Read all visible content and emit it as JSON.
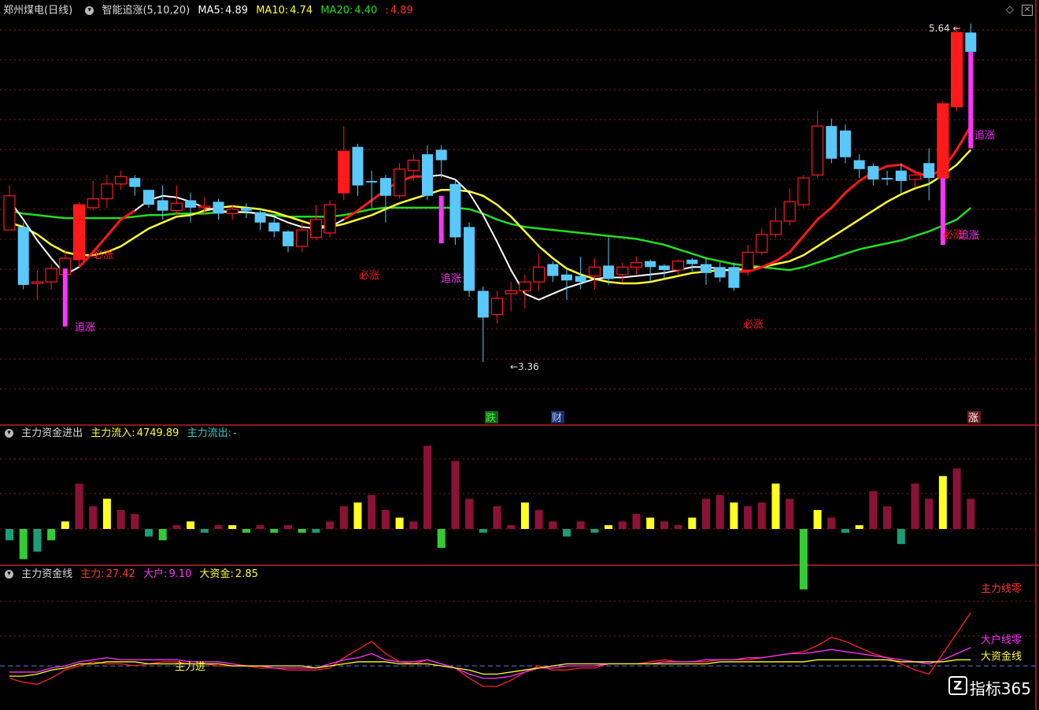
{
  "main_panel": {
    "symbol": "郑州煤电",
    "period": "(日线)",
    "indicator": "智能追涨(5,10,20)",
    "ma5_label": "MA5:",
    "ma5_value": "4.89",
    "ma10_label": "MA10:",
    "ma10_value": "4.74",
    "ma20_label": "MA20:",
    "ma20_value": "4.40",
    "extra_value": "4.89",
    "high_label": "5.64",
    "low_label": "3.36",
    "signal_labels": [
      "追涨",
      "必涨",
      "必涨",
      "追涨",
      "必涨",
      "追涨",
      "必涨",
      "追涨"
    ],
    "event_labels": [
      "跌",
      "财",
      "涨"
    ]
  },
  "flow_panel": {
    "title": "主力资金进出",
    "inflow_label": "主力流入:",
    "inflow_value": "4749.89",
    "outflow_label": "主力流出:",
    "outflow_value": "-"
  },
  "line_panel": {
    "title": "主力资金线",
    "zl_label": "主力:",
    "zl_value": "27.42",
    "dh_label": "大户:",
    "dh_value": "9.10",
    "dzj_label": "大资金:",
    "dzj_value": "2.85",
    "annot_main_in": "主力进",
    "annot_zl": "主力线零",
    "annot_dh": "大户线零",
    "annot_dzj": "大资金线"
  },
  "watermark": "指标365",
  "colors": {
    "up": "#ff1a1a",
    "down": "#5ac8fa",
    "ma5": "#ffffff",
    "ma10": "#ffff33",
    "ma20": "#22dd22",
    "magenta": "#ff33ff",
    "grid": "#8b1a1a"
  },
  "chart_data": [
    {
      "type": "candlestick",
      "title": "郑州煤电 (日线)",
      "ohlc": [
        [
          4.25,
          4.48,
          4.25,
          4.55
        ],
        [
          4.27,
          3.88,
          3.85,
          4.3
        ],
        [
          3.89,
          3.9,
          3.78,
          3.98
        ],
        [
          3.9,
          3.99,
          3.85,
          4.02
        ],
        [
          3.95,
          4.06,
          3.92,
          4.12
        ],
        [
          4.05,
          4.42,
          4.0,
          4.44
        ],
        [
          4.4,
          4.46,
          4.38,
          4.58
        ],
        [
          4.46,
          4.56,
          4.4,
          4.62
        ],
        [
          4.56,
          4.61,
          4.52,
          4.65
        ],
        [
          4.6,
          4.54,
          4.48,
          4.62
        ],
        [
          4.52,
          4.42,
          4.4,
          4.52
        ],
        [
          4.45,
          4.38,
          4.32,
          4.55
        ],
        [
          4.38,
          4.43,
          4.35,
          4.55
        ],
        [
          4.45,
          4.4,
          4.3,
          4.5
        ],
        [
          4.4,
          4.41,
          4.35,
          4.47
        ],
        [
          4.44,
          4.36,
          4.32,
          4.46
        ],
        [
          4.36,
          4.39,
          4.32,
          4.42
        ],
        [
          4.4,
          4.38,
          4.33,
          4.43
        ],
        [
          4.37,
          4.3,
          4.25,
          4.4
        ],
        [
          4.3,
          4.24,
          4.2,
          4.33
        ],
        [
          4.24,
          4.14,
          4.1,
          4.25
        ],
        [
          4.14,
          4.25,
          4.1,
          4.3
        ],
        [
          4.2,
          4.32,
          4.18,
          4.42
        ],
        [
          4.23,
          4.42,
          4.2,
          4.45
        ],
        [
          4.5,
          4.78,
          4.45,
          4.95
        ],
        [
          4.81,
          4.55,
          4.48,
          4.83
        ],
        [
          4.58,
          4.57,
          4.4,
          4.65
        ],
        [
          4.6,
          4.48,
          4.3,
          4.62
        ],
        [
          4.48,
          4.66,
          4.46,
          4.7
        ],
        [
          4.65,
          4.72,
          4.58,
          4.76
        ],
        [
          4.76,
          4.48,
          4.45,
          4.82
        ],
        [
          4.79,
          4.72,
          4.6,
          4.82
        ],
        [
          4.56,
          4.2,
          4.15,
          4.58
        ],
        [
          4.27,
          3.84,
          3.8,
          4.3
        ],
        [
          3.84,
          3.66,
          3.36,
          3.87
        ],
        [
          3.68,
          3.79,
          3.62,
          3.84
        ],
        [
          3.82,
          3.84,
          3.7,
          3.9
        ],
        [
          3.84,
          3.9,
          3.72,
          3.95
        ],
        [
          3.9,
          4.0,
          3.84,
          4.09
        ],
        [
          4.02,
          3.94,
          3.9,
          4.04
        ],
        [
          3.95,
          3.91,
          3.78,
          3.98
        ],
        [
          3.94,
          3.9,
          3.85,
          4.07
        ],
        [
          3.94,
          4.0,
          3.85,
          4.06
        ],
        [
          4.01,
          3.92,
          3.88,
          4.2
        ],
        [
          3.95,
          4.0,
          3.9,
          4.03
        ],
        [
          4.0,
          4.03,
          3.95,
          4.07
        ],
        [
          4.04,
          4.0,
          3.9,
          4.05
        ],
        [
          4.01,
          3.98,
          3.92,
          4.02
        ],
        [
          3.98,
          4.04,
          3.95,
          4.05
        ],
        [
          4.05,
          4.02,
          3.97,
          4.06
        ],
        [
          4.02,
          3.96,
          3.88,
          4.06
        ],
        [
          4.0,
          3.93,
          3.9,
          4.03
        ],
        [
          4.0,
          3.86,
          3.84,
          4.03
        ],
        [
          3.98,
          4.1,
          3.94,
          4.15
        ],
        [
          4.1,
          4.22,
          4.08,
          4.26
        ],
        [
          4.22,
          4.31,
          4.2,
          4.4
        ],
        [
          4.31,
          4.44,
          4.28,
          4.53
        ],
        [
          4.42,
          4.6,
          4.4,
          4.62
        ],
        [
          4.62,
          4.95,
          4.6,
          5.05
        ],
        [
          4.95,
          4.73,
          4.7,
          5.0
        ],
        [
          4.92,
          4.74,
          4.7,
          4.96
        ],
        [
          4.72,
          4.66,
          4.6,
          4.76
        ],
        [
          4.68,
          4.59,
          4.55,
          4.7
        ],
        [
          4.6,
          4.59,
          4.55,
          4.65
        ],
        [
          4.65,
          4.58,
          4.5,
          4.7
        ],
        [
          4.59,
          4.62,
          4.54,
          4.64
        ],
        [
          4.7,
          4.6,
          4.45,
          4.8
        ],
        [
          4.6,
          5.1,
          4.58,
          5.12
        ],
        [
          5.08,
          5.58,
          5.05,
          5.62
        ],
        [
          5.58,
          5.45,
          5.35,
          5.64
        ]
      ],
      "ma5": [
        4.45,
        4.32,
        4.18,
        4.06,
        3.95,
        4.0,
        4.1,
        4.21,
        4.32,
        4.38,
        4.45,
        4.48,
        4.47,
        4.44,
        4.4,
        4.38,
        4.37,
        4.37,
        4.36,
        4.34,
        4.3,
        4.27,
        4.26,
        4.27,
        4.32,
        4.38,
        4.45,
        4.52,
        4.58,
        4.61,
        4.61,
        4.62,
        4.59,
        4.5,
        4.35,
        4.17,
        3.98,
        3.82,
        3.78,
        3.82,
        3.86,
        3.89,
        3.92,
        3.93,
        3.93,
        3.94,
        3.95,
        3.96,
        3.98,
        4.0,
        4.0,
        3.99,
        3.97,
        3.97,
        4.0,
        4.04,
        4.1,
        4.21,
        4.32,
        4.4,
        4.5,
        4.58,
        4.64,
        4.68,
        4.69,
        4.64,
        4.61,
        4.66,
        4.79,
        4.95
      ],
      "ma10": [
        4.3,
        4.27,
        4.22,
        4.15,
        4.1,
        4.08,
        4.08,
        4.1,
        4.14,
        4.2,
        4.26,
        4.3,
        4.34,
        4.35,
        4.38,
        4.4,
        4.41,
        4.4,
        4.39,
        4.37,
        4.34,
        4.31,
        4.28,
        4.27,
        4.29,
        4.32,
        4.35,
        4.39,
        4.43,
        4.46,
        4.49,
        4.52,
        4.52,
        4.51,
        4.48,
        4.42,
        4.34,
        4.24,
        4.14,
        4.06,
        3.99,
        3.95,
        3.92,
        3.9,
        3.89,
        3.89,
        3.9,
        3.92,
        3.94,
        3.96,
        3.97,
        3.98,
        3.98,
        3.99,
        4.0,
        4.02,
        4.04,
        4.08,
        4.14,
        4.2,
        4.26,
        4.32,
        4.38,
        4.44,
        4.49,
        4.53,
        4.56,
        4.62,
        4.69,
        4.79
      ],
      "ma20": [
        4.38,
        4.36,
        4.35,
        4.34,
        4.33,
        4.33,
        4.33,
        4.33,
        4.33,
        4.34,
        4.35,
        4.35,
        4.36,
        4.36,
        4.36,
        4.37,
        4.37,
        4.37,
        4.36,
        4.35,
        4.34,
        4.34,
        4.34,
        4.34,
        4.35,
        4.37,
        4.39,
        4.4,
        4.4,
        4.4,
        4.4,
        4.4,
        4.4,
        4.39,
        4.36,
        4.32,
        4.29,
        4.27,
        4.26,
        4.25,
        4.24,
        4.23,
        4.22,
        4.21,
        4.2,
        4.19,
        4.17,
        4.15,
        4.12,
        4.09,
        4.06,
        4.04,
        4.02,
        4.01,
        4.0,
        3.99,
        3.98,
        4.0,
        4.03,
        4.06,
        4.09,
        4.12,
        4.14,
        4.16,
        4.18,
        4.21,
        4.24,
        4.28,
        4.32,
        4.4
      ]
    },
    {
      "type": "bar",
      "title": "主力资金进出",
      "values": [
        -3,
        -8,
        -6,
        -3,
        2,
        12,
        6,
        8,
        5,
        4,
        -2,
        -3,
        1,
        2,
        -1,
        1,
        1,
        -1,
        1,
        -1,
        1,
        -1,
        -1,
        2,
        6,
        7,
        9,
        5,
        3,
        2,
        22,
        -5,
        18,
        8,
        -1,
        6,
        1,
        7,
        5,
        2,
        -2,
        2,
        -1,
        1,
        2,
        4,
        3,
        2,
        1,
        3,
        8,
        9,
        7,
        6,
        7,
        12,
        8,
        -16,
        5,
        3,
        -1,
        1,
        10,
        6,
        -4,
        12,
        8,
        14,
        16,
        8
      ]
    },
    {
      "type": "line",
      "title": "主力资金线",
      "series": [
        {
          "name": "主力",
          "values": [
            -6,
            -8,
            -9,
            -6,
            -2,
            0,
            2,
            1,
            1,
            0,
            1,
            2,
            2,
            1,
            1,
            0,
            0,
            0,
            -1,
            -1,
            -2,
            -2,
            -2,
            -1,
            4,
            8,
            12,
            6,
            2,
            1,
            3,
            1,
            -1,
            -6,
            -10,
            -10,
            -7,
            -3,
            0,
            -2,
            -2,
            -1,
            -1,
            1,
            1,
            1,
            2,
            3,
            2,
            2,
            2,
            3,
            3,
            3,
            4,
            5,
            6,
            7,
            10,
            14,
            12,
            9,
            6,
            4,
            1,
            -2,
            -4,
            6,
            16,
            26
          ]
        },
        {
          "name": "大户",
          "values": [
            -3,
            -3,
            -3,
            -1,
            0,
            2,
            3,
            4,
            3,
            3,
            3,
            3,
            3,
            2,
            2,
            2,
            1,
            0,
            0,
            -1,
            -1,
            -1,
            -1,
            1,
            3,
            4,
            6,
            3,
            2,
            2,
            3,
            1,
            -1,
            -4,
            -6,
            -6,
            -5,
            -3,
            -1,
            -1,
            0,
            0,
            0,
            1,
            1,
            1,
            1,
            2,
            2,
            2,
            3,
            3,
            3,
            4,
            4,
            5,
            6,
            6,
            7,
            8,
            7,
            6,
            5,
            4,
            3,
            2,
            1,
            3,
            6,
            9
          ]
        },
        {
          "name": "大资金",
          "values": [
            -5,
            -5,
            -4,
            -2,
            -1,
            1,
            1,
            2,
            2,
            2,
            1,
            1,
            1,
            1,
            1,
            1,
            0,
            0,
            0,
            0,
            0,
            0,
            -1,
            0,
            1,
            2,
            2,
            2,
            1,
            1,
            1,
            0,
            -1,
            -2,
            -4,
            -4,
            -3,
            -2,
            -1,
            0,
            1,
            1,
            1,
            1,
            1,
            1,
            1,
            1,
            1,
            1,
            1,
            2,
            2,
            2,
            2,
            2,
            2,
            2,
            3,
            3,
            3,
            3,
            3,
            3,
            2,
            2,
            2,
            2,
            3,
            3
          ]
        }
      ]
    }
  ]
}
